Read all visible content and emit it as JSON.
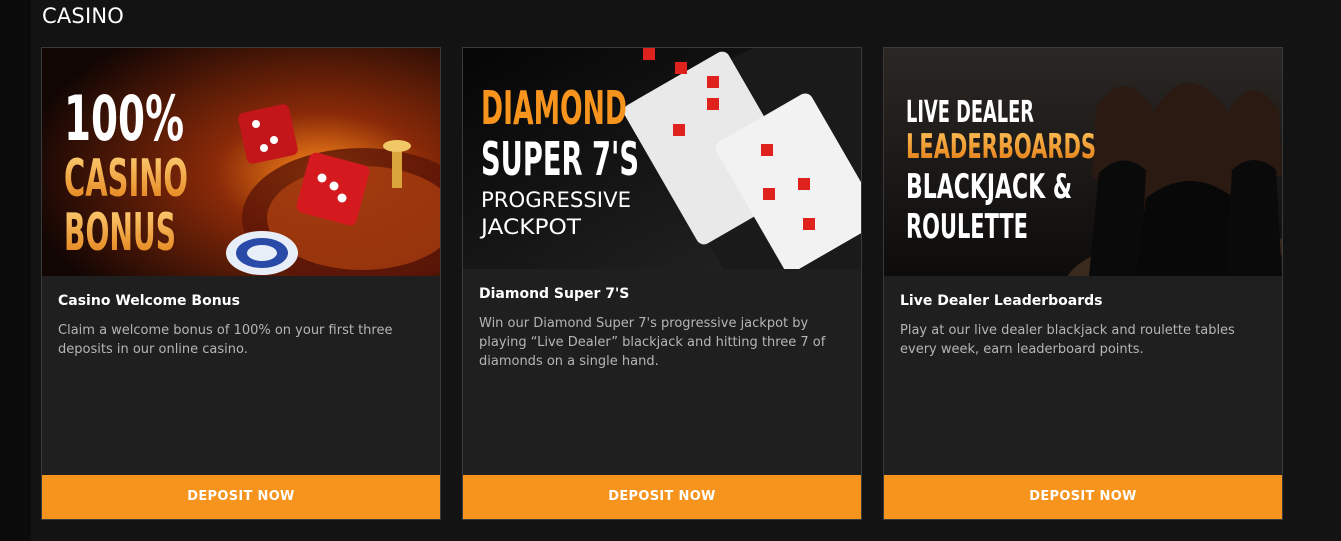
{
  "section": {
    "title": "CASINO"
  },
  "cards": [
    {
      "banner": {
        "line1": "100%",
        "line2": "CASINO",
        "line3": "BONUS"
      },
      "title": "Casino Welcome Bonus",
      "description": "Claim a welcome bonus of 100% on your first three deposits in our online casino.",
      "button_label": "DEPOSIT NOW"
    },
    {
      "banner": {
        "line1": "DIAMOND",
        "line2": "SUPER 7'S",
        "line3": "PROGRESSIVE",
        "line4": "JACKPOT"
      },
      "title": "Diamond Super 7'S",
      "description": "Win our Diamond Super 7's progressive jackpot by playing “Live Dealer” blackjack and hitting three 7 of diamonds on a single hand.",
      "button_label": "DEPOSIT NOW"
    },
    {
      "banner": {
        "line1": "LIVE DEALER",
        "line2": "LEADERBOARDS",
        "line3": "BLACKJACK &",
        "line4": "ROULETTE"
      },
      "title": "Live Dealer Leaderboards",
      "description": "Play at our live dealer blackjack and roulette tables every week, earn leaderboard points.",
      "button_label": "DEPOSIT NOW"
    }
  ],
  "colors": {
    "accent": "#f7941d",
    "background": "#131313",
    "card": "#1f1f1f",
    "text": "#ffffff",
    "muted_text": "#b5b5b5",
    "card_red": "#e0221f"
  }
}
